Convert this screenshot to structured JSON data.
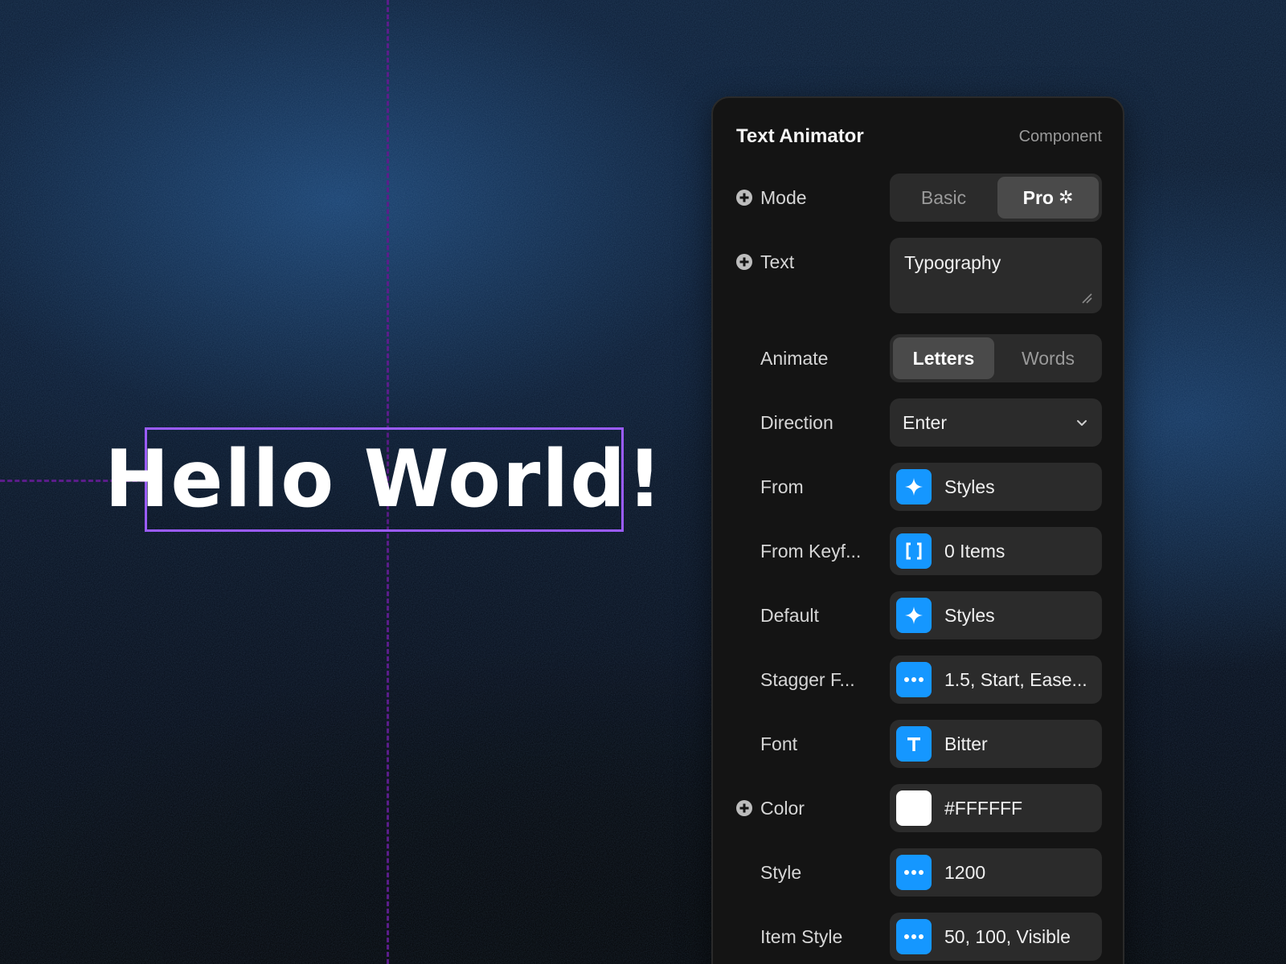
{
  "canvas": {
    "headline": "Hello World!"
  },
  "panel": {
    "title": "Text Animator",
    "subtitle": "Component",
    "rows": {
      "mode": {
        "label": "Mode",
        "options": [
          "Basic",
          "Pro"
        ],
        "pro_symbol": "✲",
        "selected": "Pro"
      },
      "text": {
        "label": "Text",
        "value": "Typography"
      },
      "animate": {
        "label": "Animate",
        "options": [
          "Letters",
          "Words"
        ],
        "selected": "Letters"
      },
      "direction": {
        "label": "Direction",
        "value": "Enter"
      },
      "from": {
        "label": "From",
        "icon": "sparkle-icon",
        "value": "Styles"
      },
      "from_keyframes": {
        "label": "From Keyf...",
        "icon": "brackets-icon",
        "value": "0 Items"
      },
      "default": {
        "label": "Default",
        "icon": "sparkle-icon",
        "value": "Styles"
      },
      "stagger": {
        "label": "Stagger F...",
        "icon": "ellipsis-icon",
        "value": "1.5, Start, Ease..."
      },
      "font": {
        "label": "Font",
        "icon": "text-t-icon",
        "value": "Bitter"
      },
      "color": {
        "label": "Color",
        "swatch": "#FFFFFF",
        "value": "#FFFFFF"
      },
      "style": {
        "label": "Style",
        "icon": "ellipsis-icon",
        "value": "1200"
      },
      "item_style": {
        "label": "Item Style",
        "icon": "ellipsis-icon",
        "value": "50, 100, Visible"
      }
    }
  },
  "colors": {
    "accent_blue": "#1597FF",
    "selection_purple": "#9B5CFF",
    "guide_purple": "#5B1D8A",
    "panel_bg": "#141414",
    "control_bg": "#2B2B2B"
  }
}
